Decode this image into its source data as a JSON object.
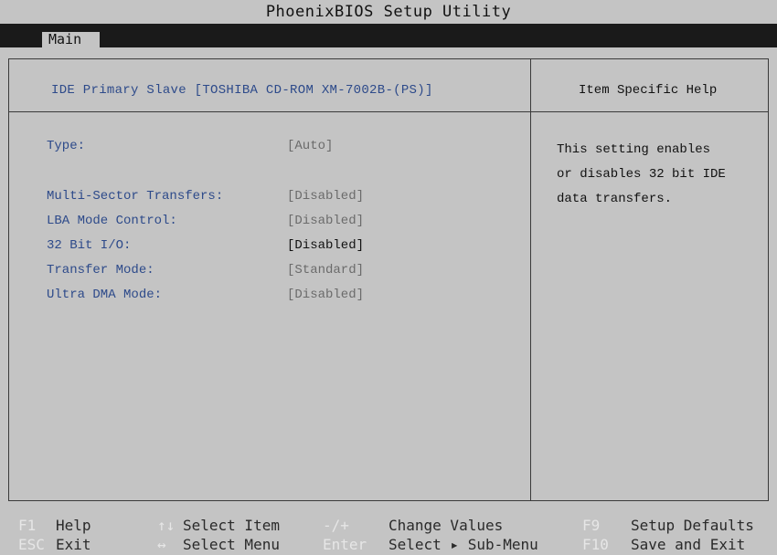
{
  "title": "PhoenixBIOS Setup Utility",
  "menu": {
    "active_tab": "Main"
  },
  "panel": {
    "title": "IDE Primary Slave [TOSHIBA CD-ROM XM-7002B-(PS)]",
    "help_title": "Item Specific Help",
    "settings": [
      {
        "label": "Type:",
        "value": "[Auto]"
      },
      {
        "label": "Multi-Sector Transfers:",
        "value": "[Disabled]"
      },
      {
        "label": "LBA Mode Control:",
        "value": "[Disabled]"
      },
      {
        "label": "32 Bit I/O:",
        "value": "[Disabled]"
      },
      {
        "label": "Transfer Mode:",
        "value": "[Standard]"
      },
      {
        "label": "Ultra DMA Mode:",
        "value": "[Disabled]"
      }
    ],
    "help_text": [
      "This setting enables",
      "or disables 32 bit IDE",
      "data transfers."
    ]
  },
  "footer": {
    "row1": [
      {
        "key": "F1",
        "desc": "Help"
      },
      {
        "key": "↑↓",
        "desc": "Select Item"
      },
      {
        "key": "-/+",
        "desc": "Change Values"
      },
      {
        "key": "F9",
        "desc": "Setup Defaults"
      }
    ],
    "row2": [
      {
        "key": "ESC",
        "desc": "Exit"
      },
      {
        "key": "↔",
        "desc": "Select Menu"
      },
      {
        "key": "Enter",
        "desc": "Select ▸ Sub-Menu"
      },
      {
        "key": "F10",
        "desc": "Save and Exit"
      }
    ]
  }
}
